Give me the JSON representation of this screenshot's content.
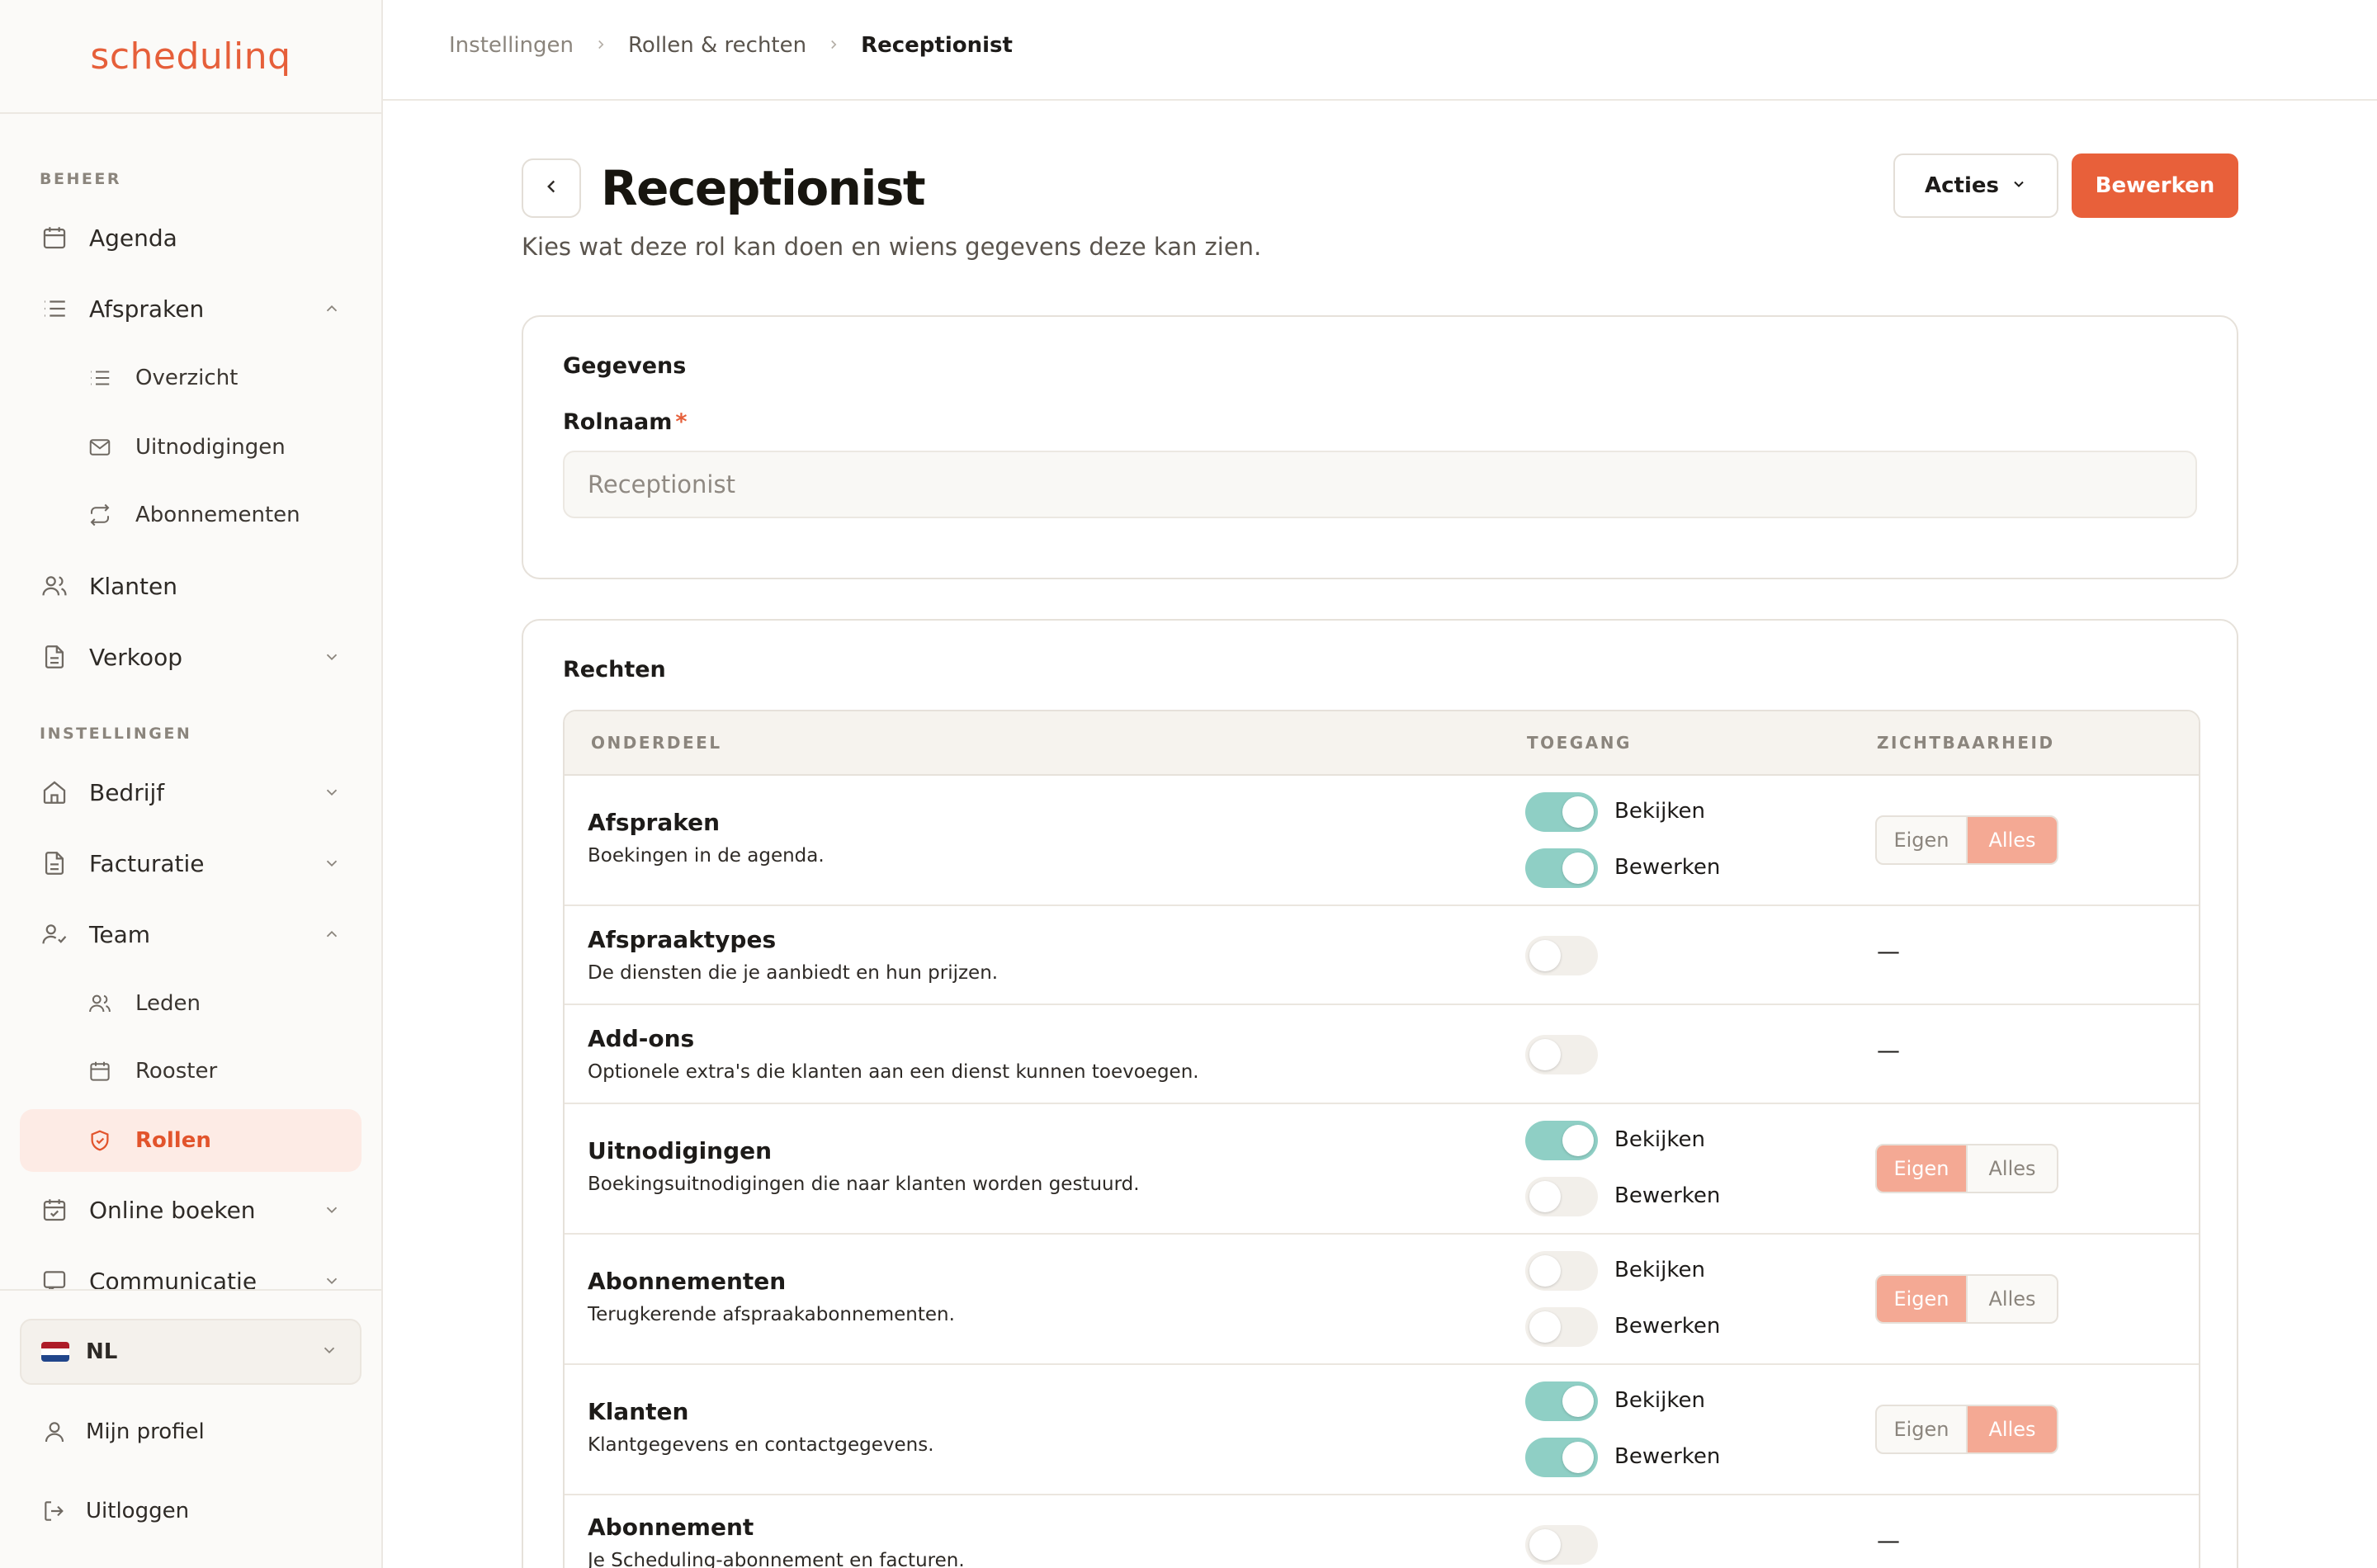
{
  "brand": {
    "logo_text": "schedulinq",
    "accent": "#e8603a"
  },
  "sidebar": {
    "sections": [
      {
        "label": "BEHEER"
      },
      {
        "label": "INSTELLINGEN"
      }
    ],
    "items": [
      {
        "label": "Agenda",
        "icon": "calendar-icon"
      },
      {
        "label": "Afspraken",
        "icon": "list-icon",
        "expanded": true
      },
      {
        "label": "Overzicht",
        "icon": "list-icon"
      },
      {
        "label": "Uitnodigingen",
        "icon": "mail-icon"
      },
      {
        "label": "Abonnementen",
        "icon": "repeat-icon"
      },
      {
        "label": "Klanten",
        "icon": "users-icon"
      },
      {
        "label": "Verkoop",
        "icon": "document-icon",
        "expanded": false
      },
      {
        "label": "Bedrijf",
        "icon": "home-icon",
        "expanded": false
      },
      {
        "label": "Facturatie",
        "icon": "document-icon",
        "expanded": false
      },
      {
        "label": "Team",
        "icon": "user-check-icon",
        "expanded": true
      },
      {
        "label": "Leden",
        "icon": "users-icon"
      },
      {
        "label": "Rooster",
        "icon": "calendar-icon"
      },
      {
        "label": "Rollen",
        "icon": "shield-icon",
        "active": true
      },
      {
        "label": "Online boeken",
        "icon": "calendar-check-icon",
        "expanded": false
      },
      {
        "label": "Communicatie",
        "icon": "message-icon",
        "expanded": false
      }
    ],
    "language": {
      "label": "NL",
      "flag": [
        "#ae1c28",
        "#ffffff",
        "#21468b"
      ]
    },
    "footer": [
      {
        "label": "Mijn profiel",
        "icon": "user-icon"
      },
      {
        "label": "Uitloggen",
        "icon": "logout-icon"
      }
    ]
  },
  "breadcrumb": [
    "Instellingen",
    "Rollen & rechten",
    "Receptionist"
  ],
  "header": {
    "title": "Receptionist",
    "subtitle": "Kies wat deze rol kan doen en wiens gegevens deze kan zien.",
    "actions_label": "Acties",
    "edit_label": "Bewerken"
  },
  "details": {
    "title": "Gegevens",
    "rolename_label": "Rolnaam",
    "required_mark": "*",
    "rolename_placeholder": "Receptionist"
  },
  "rights": {
    "title": "Rechten",
    "columns": [
      "ONDERDEEL",
      "TOEGANG",
      "ZICHTBAARHEID"
    ],
    "view_label": "Bekijken",
    "edit_label": "Bewerken",
    "own_label": "Eigen",
    "all_label": "Alles",
    "none_mark": "—",
    "rows": [
      {
        "name": "Afspraken",
        "desc": "Boekingen in de agenda.",
        "view": true,
        "edit": true,
        "visibility": "Alles"
      },
      {
        "name": "Afspraaktypes",
        "desc": "De diensten die je aanbiedt en hun prijzen.",
        "single": false
      },
      {
        "name": "Add-ons",
        "desc": "Optionele extra's die klanten aan een dienst kunnen toevoegen.",
        "single": false
      },
      {
        "name": "Uitnodigingen",
        "desc": "Boekingsuitnodigingen die naar klanten worden gestuurd.",
        "view": true,
        "edit": false,
        "visibility": "Eigen"
      },
      {
        "name": "Abonnementen",
        "desc": "Terugkerende afspraakabonnementen.",
        "view": false,
        "edit": false,
        "visibility": "Eigen"
      },
      {
        "name": "Klanten",
        "desc": "Klantgegevens en contactgegevens.",
        "view": true,
        "edit": true,
        "visibility": "Alles"
      },
      {
        "name": "Abonnement",
        "desc": "Je Scheduling-abonnement en facturen.",
        "single": false
      }
    ]
  }
}
